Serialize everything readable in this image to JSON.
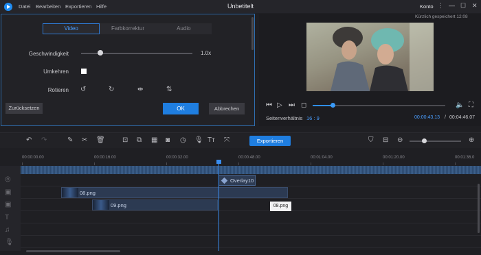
{
  "menu": {
    "datei": "Datei",
    "bearbeiten": "Bearbeiten",
    "exportieren": "Exportieren",
    "hilfe": "Hilfe"
  },
  "window": {
    "title": "Unbetitelt",
    "account": "Konto"
  },
  "editor": {
    "tabs": [
      "Video",
      "Farbkorrektur",
      "Audio"
    ],
    "speed_label": "Geschwindigkeit",
    "speed_value": "1.0x",
    "speed_level": 0.17,
    "reverse_label": "Umkehren",
    "rotate_label": "Rotieren",
    "reset_label": "Zurücksetzen",
    "ok_label": "OK",
    "cancel_label": "Abbrechen"
  },
  "preview": {
    "saved_status": "Kürzlich gespeichert 12:08",
    "aspect_label": "Seitenverhältnis",
    "aspect_value": "16 : 9",
    "time_current": "00:00:43.13",
    "time_separator": "/",
    "time_total": "00:04:46.07",
    "progress": 0.15
  },
  "toolbar": {
    "export_label": "Exportieren"
  },
  "timeline": {
    "ticks": [
      "00:00:00.00",
      "00:00:16.00",
      "00:00:32.00",
      "00:00:48.00",
      "00:01:04.00",
      "00:01:20.00",
      "00:01:36.0"
    ],
    "overlay_clip": "Overlay10",
    "clip_1": "08.png",
    "clip_2": "09.png",
    "tooltip": "08.png"
  },
  "colors": {
    "accent": "#1f7ee0",
    "highlight": "#4a9eff",
    "background": "#1f1f23"
  }
}
